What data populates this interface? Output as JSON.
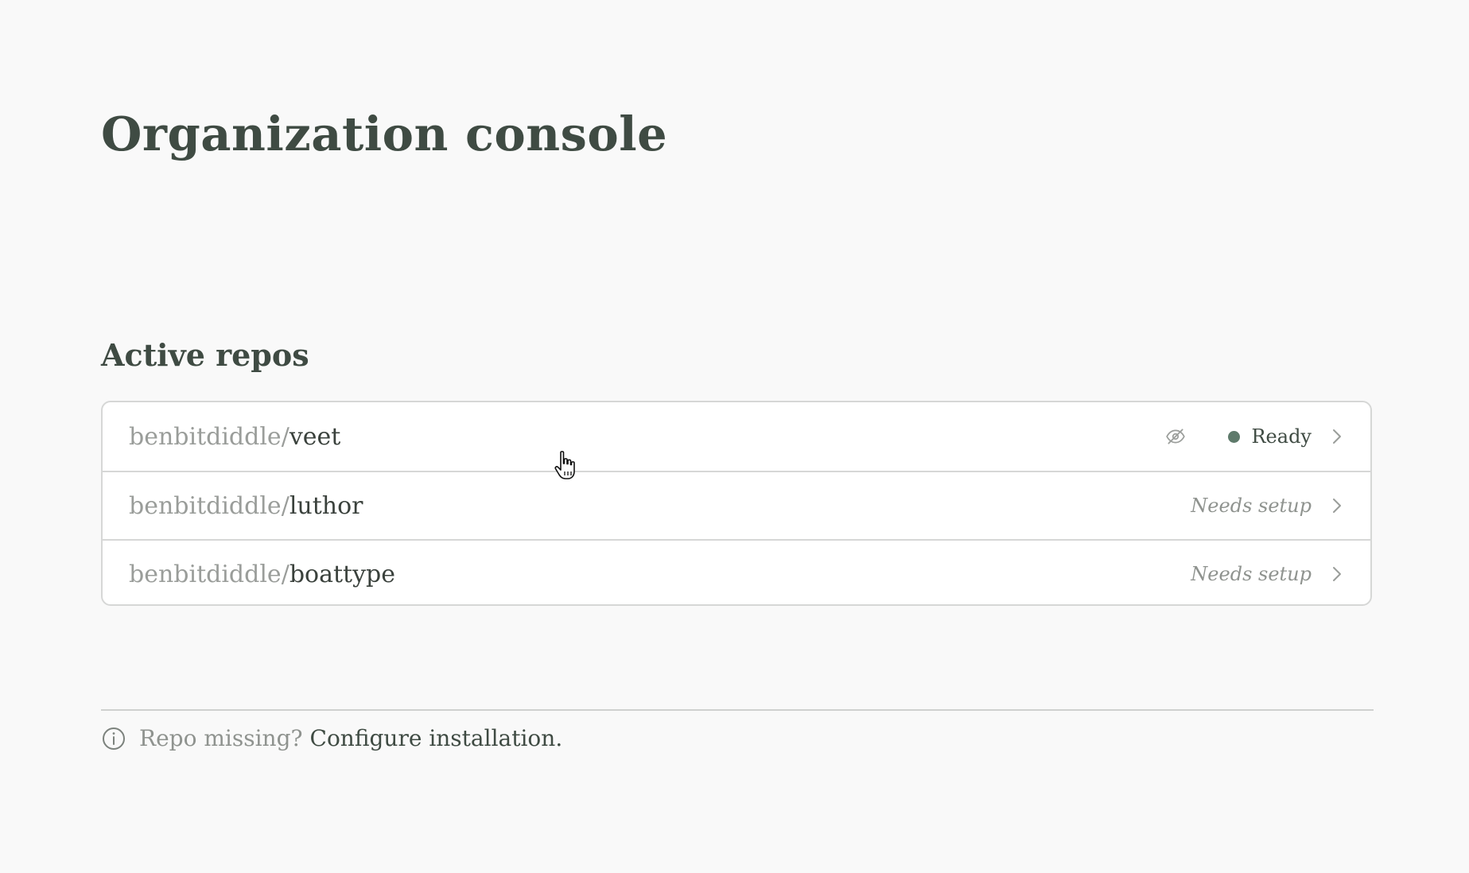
{
  "page": {
    "title": "Organization console"
  },
  "repos_section": {
    "title": "Active repos",
    "repos": [
      {
        "owner": "benbitdiddle",
        "separator": "/",
        "name": "veet",
        "status": "Ready",
        "hidden_icon": "eye-off-icon"
      },
      {
        "owner": "benbitdiddle",
        "separator": "/",
        "name": "luthor",
        "status": "Needs setup"
      },
      {
        "owner": "benbitdiddle",
        "separator": "/",
        "name": "boattype",
        "status": "Needs setup"
      }
    ]
  },
  "footer": {
    "icon": "info-icon",
    "question": "Repo missing?",
    "link_label": "Configure installation."
  },
  "colors": {
    "background": "#f9f9f9",
    "heading": "#3f4b43",
    "muted": "#9a9d9a",
    "ready_dot": "#5e7a6b",
    "border": "#d6d7d6"
  }
}
